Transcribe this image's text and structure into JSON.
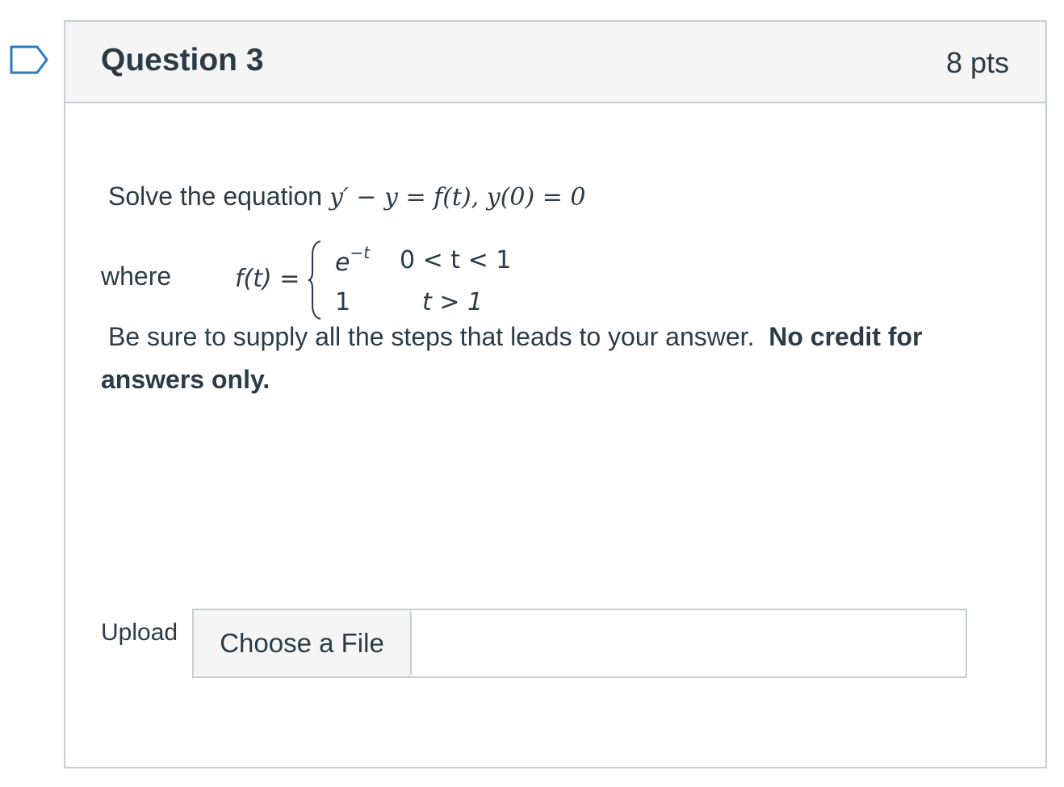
{
  "question": {
    "title": "Question 3",
    "points": "8 pts"
  },
  "prompt": {
    "lead": "Solve the equation ",
    "equation": "y′ − y = f(t),   y(0) = 0",
    "where_label": "where",
    "piecewise": {
      "lhs": "f(t) =",
      "row1_expr_base": "e",
      "row1_expr_exp": "−t",
      "row1_cond": "0 < t < 1",
      "row2_expr": "1",
      "row2_cond": "t > 1"
    },
    "instruction_plain": "Be sure to supply all the steps that leads to your answer.",
    "instruction_bold_1": "No credit for",
    "instruction_bold_2": "answers only."
  },
  "upload": {
    "label": "Upload",
    "button_label": "Choose a File"
  },
  "icons": {
    "flag": "bookmark-flag-icon"
  },
  "colors": {
    "flag_outline": "#2b7abc",
    "text": "#2d3b45",
    "border": "#c7cdd1",
    "header_bg": "#f5f5f5"
  }
}
